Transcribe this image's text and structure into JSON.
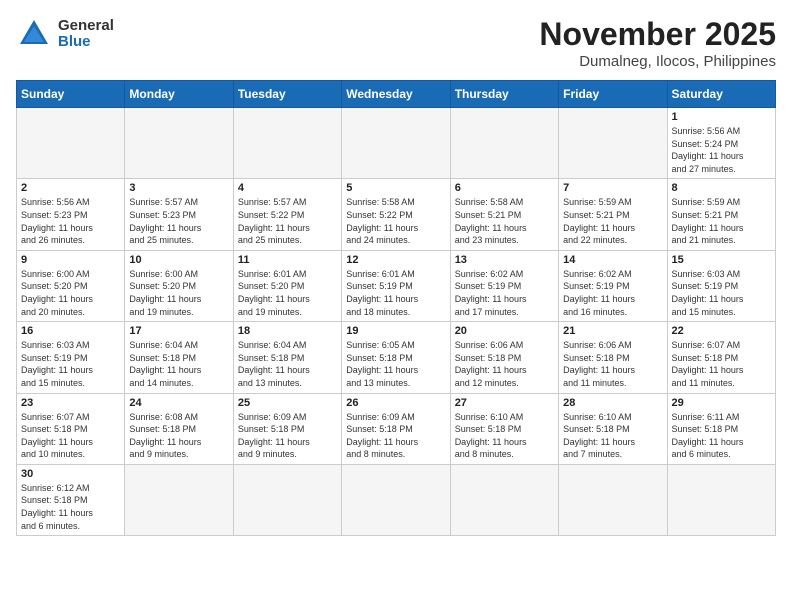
{
  "header": {
    "logo_general": "General",
    "logo_blue": "Blue",
    "month_title": "November 2025",
    "location": "Dumalneg, Ilocos, Philippines"
  },
  "weekdays": [
    "Sunday",
    "Monday",
    "Tuesday",
    "Wednesday",
    "Thursday",
    "Friday",
    "Saturday"
  ],
  "days": [
    {
      "date": "",
      "info": ""
    },
    {
      "date": "",
      "info": ""
    },
    {
      "date": "",
      "info": ""
    },
    {
      "date": "",
      "info": ""
    },
    {
      "date": "",
      "info": ""
    },
    {
      "date": "",
      "info": ""
    },
    {
      "date": "1",
      "info": "Sunrise: 5:56 AM\nSunset: 5:24 PM\nDaylight: 11 hours\nand 27 minutes."
    },
    {
      "date": "2",
      "info": "Sunrise: 5:56 AM\nSunset: 5:23 PM\nDaylight: 11 hours\nand 26 minutes."
    },
    {
      "date": "3",
      "info": "Sunrise: 5:57 AM\nSunset: 5:23 PM\nDaylight: 11 hours\nand 25 minutes."
    },
    {
      "date": "4",
      "info": "Sunrise: 5:57 AM\nSunset: 5:22 PM\nDaylight: 11 hours\nand 25 minutes."
    },
    {
      "date": "5",
      "info": "Sunrise: 5:58 AM\nSunset: 5:22 PM\nDaylight: 11 hours\nand 24 minutes."
    },
    {
      "date": "6",
      "info": "Sunrise: 5:58 AM\nSunset: 5:21 PM\nDaylight: 11 hours\nand 23 minutes."
    },
    {
      "date": "7",
      "info": "Sunrise: 5:59 AM\nSunset: 5:21 PM\nDaylight: 11 hours\nand 22 minutes."
    },
    {
      "date": "8",
      "info": "Sunrise: 5:59 AM\nSunset: 5:21 PM\nDaylight: 11 hours\nand 21 minutes."
    },
    {
      "date": "9",
      "info": "Sunrise: 6:00 AM\nSunset: 5:20 PM\nDaylight: 11 hours\nand 20 minutes."
    },
    {
      "date": "10",
      "info": "Sunrise: 6:00 AM\nSunset: 5:20 PM\nDaylight: 11 hours\nand 19 minutes."
    },
    {
      "date": "11",
      "info": "Sunrise: 6:01 AM\nSunset: 5:20 PM\nDaylight: 11 hours\nand 19 minutes."
    },
    {
      "date": "12",
      "info": "Sunrise: 6:01 AM\nSunset: 5:19 PM\nDaylight: 11 hours\nand 18 minutes."
    },
    {
      "date": "13",
      "info": "Sunrise: 6:02 AM\nSunset: 5:19 PM\nDaylight: 11 hours\nand 17 minutes."
    },
    {
      "date": "14",
      "info": "Sunrise: 6:02 AM\nSunset: 5:19 PM\nDaylight: 11 hours\nand 16 minutes."
    },
    {
      "date": "15",
      "info": "Sunrise: 6:03 AM\nSunset: 5:19 PM\nDaylight: 11 hours\nand 15 minutes."
    },
    {
      "date": "16",
      "info": "Sunrise: 6:03 AM\nSunset: 5:19 PM\nDaylight: 11 hours\nand 15 minutes."
    },
    {
      "date": "17",
      "info": "Sunrise: 6:04 AM\nSunset: 5:18 PM\nDaylight: 11 hours\nand 14 minutes."
    },
    {
      "date": "18",
      "info": "Sunrise: 6:04 AM\nSunset: 5:18 PM\nDaylight: 11 hours\nand 13 minutes."
    },
    {
      "date": "19",
      "info": "Sunrise: 6:05 AM\nSunset: 5:18 PM\nDaylight: 11 hours\nand 13 minutes."
    },
    {
      "date": "20",
      "info": "Sunrise: 6:06 AM\nSunset: 5:18 PM\nDaylight: 11 hours\nand 12 minutes."
    },
    {
      "date": "21",
      "info": "Sunrise: 6:06 AM\nSunset: 5:18 PM\nDaylight: 11 hours\nand 11 minutes."
    },
    {
      "date": "22",
      "info": "Sunrise: 6:07 AM\nSunset: 5:18 PM\nDaylight: 11 hours\nand 11 minutes."
    },
    {
      "date": "23",
      "info": "Sunrise: 6:07 AM\nSunset: 5:18 PM\nDaylight: 11 hours\nand 10 minutes."
    },
    {
      "date": "24",
      "info": "Sunrise: 6:08 AM\nSunset: 5:18 PM\nDaylight: 11 hours\nand 9 minutes."
    },
    {
      "date": "25",
      "info": "Sunrise: 6:09 AM\nSunset: 5:18 PM\nDaylight: 11 hours\nand 9 minutes."
    },
    {
      "date": "26",
      "info": "Sunrise: 6:09 AM\nSunset: 5:18 PM\nDaylight: 11 hours\nand 8 minutes."
    },
    {
      "date": "27",
      "info": "Sunrise: 6:10 AM\nSunset: 5:18 PM\nDaylight: 11 hours\nand 8 minutes."
    },
    {
      "date": "28",
      "info": "Sunrise: 6:10 AM\nSunset: 5:18 PM\nDaylight: 11 hours\nand 7 minutes."
    },
    {
      "date": "29",
      "info": "Sunrise: 6:11 AM\nSunset: 5:18 PM\nDaylight: 11 hours\nand 6 minutes."
    },
    {
      "date": "30",
      "info": "Sunrise: 6:12 AM\nSunset: 5:18 PM\nDaylight: 11 hours\nand 6 minutes."
    },
    {
      "date": "",
      "info": ""
    },
    {
      "date": "",
      "info": ""
    },
    {
      "date": "",
      "info": ""
    },
    {
      "date": "",
      "info": ""
    },
    {
      "date": "",
      "info": ""
    },
    {
      "date": "",
      "info": ""
    }
  ]
}
